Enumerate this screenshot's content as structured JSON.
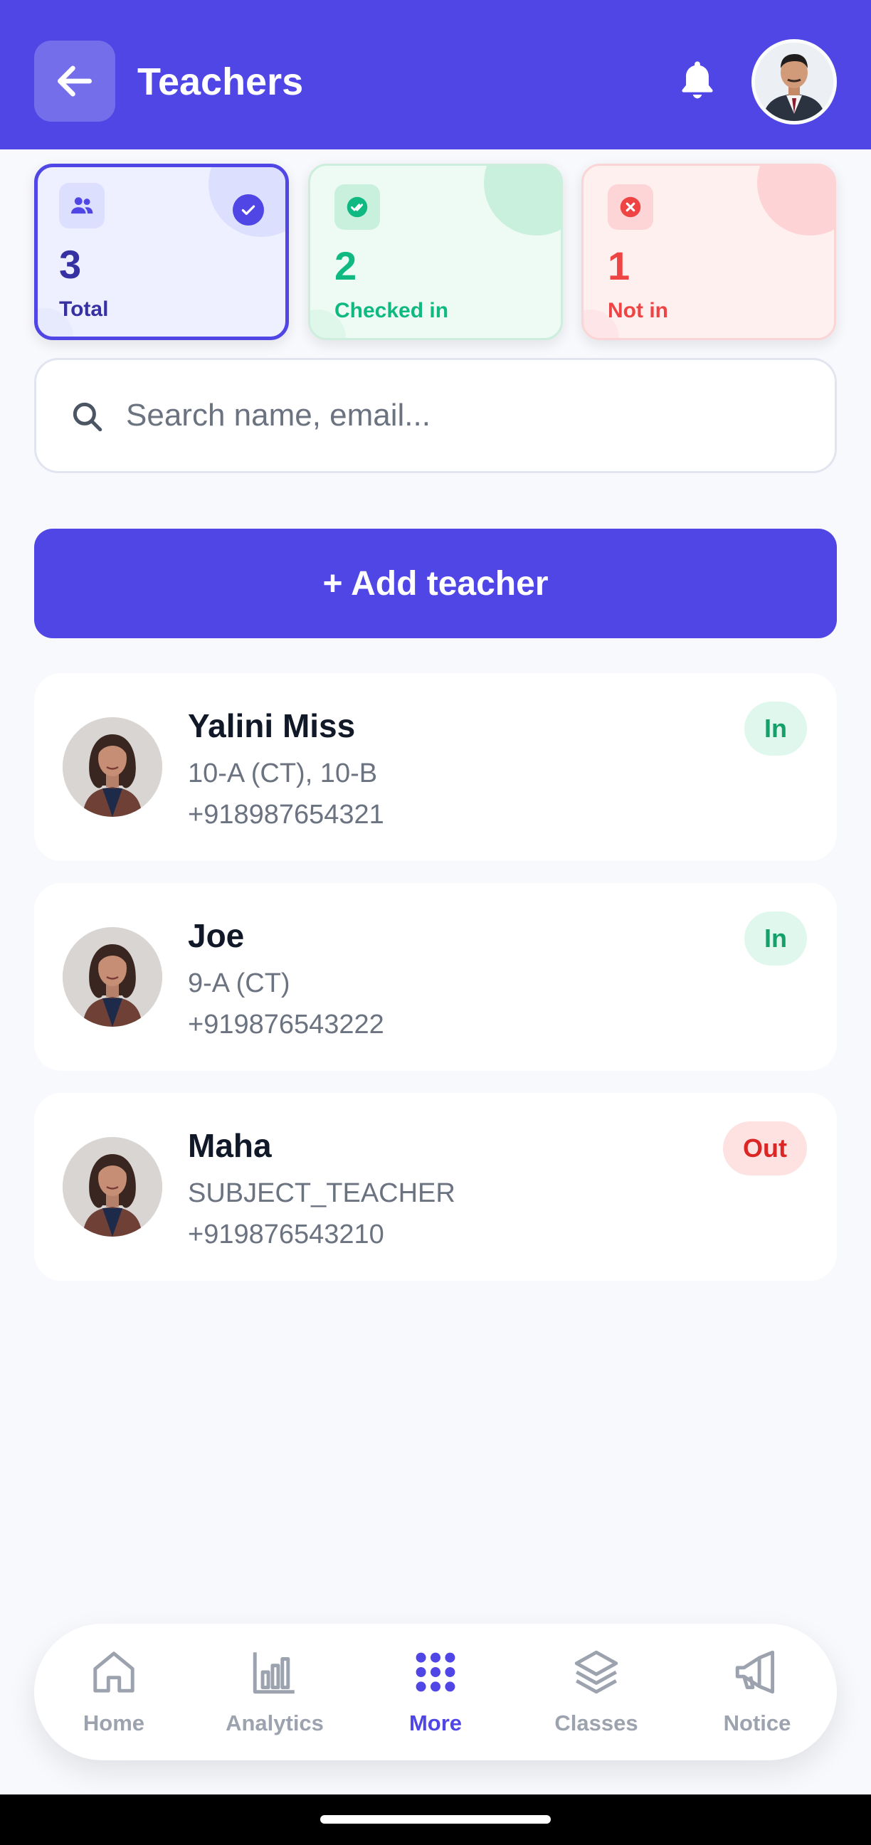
{
  "header": {
    "title": "Teachers",
    "back_icon": "arrow-left-icon",
    "bell_icon": "bell-icon",
    "avatar": "profile-avatar"
  },
  "stats": [
    {
      "value": "3",
      "label": "Total",
      "icon": "users-icon",
      "selected": true,
      "color": "#4f46e5"
    },
    {
      "value": "2",
      "label": "Checked in",
      "icon": "double-check-icon",
      "selected": false,
      "color": "#10b981"
    },
    {
      "value": "1",
      "label": "Not in",
      "icon": "x-circle-icon",
      "selected": false,
      "color": "#ef4444"
    }
  ],
  "search": {
    "placeholder": "Search name, email...",
    "value": ""
  },
  "actions": {
    "add_teacher_label": "+ Add teacher"
  },
  "teachers": [
    {
      "name": "Yalini Miss",
      "classes": "10-A (CT), 10-B",
      "phone": "+918987654321",
      "status": "In"
    },
    {
      "name": "Joe",
      "classes": "9-A (CT)",
      "phone": "+919876543222",
      "status": "In"
    },
    {
      "name": "Maha",
      "classes": "SUBJECT_TEACHER",
      "phone": "+919876543210",
      "status": "Out"
    }
  ],
  "nav": {
    "items": [
      {
        "label": "Home",
        "icon": "home-icon",
        "active": false
      },
      {
        "label": "Analytics",
        "icon": "bar-chart-icon",
        "active": false
      },
      {
        "label": "More",
        "icon": "grid-dots-icon",
        "active": true
      },
      {
        "label": "Classes",
        "icon": "layers-icon",
        "active": false
      },
      {
        "label": "Notice",
        "icon": "megaphone-icon",
        "active": false
      }
    ]
  },
  "colors": {
    "primary": "#4f46e5",
    "success": "#10b981",
    "danger": "#ef4444",
    "background": "#f8f9fc"
  }
}
